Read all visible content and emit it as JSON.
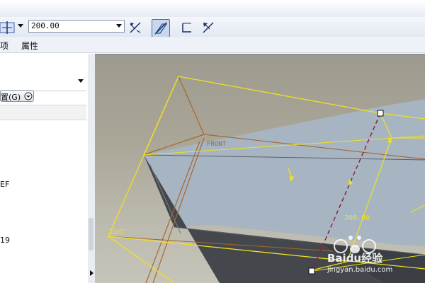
{
  "toolbar": {
    "depth_value": "200.00"
  },
  "menu": {
    "tab_options_partial": "项",
    "tab_properties": "属性"
  },
  "panel": {
    "placement_button": "置(G)",
    "tree_items": [
      "EF",
      "19"
    ]
  },
  "viewport": {
    "plane_front": "FRONT",
    "plane_right": "IGHT",
    "dimension": "200.00"
  },
  "watermark": {
    "brand": "Baidu经验",
    "url": "jingyan.baidu.com"
  },
  "colors": {
    "datum_yellow": "#f0e020",
    "plane_orange": "#a5672f",
    "surface_blue": "#a7b5c2",
    "dark_face": "#44484d"
  }
}
